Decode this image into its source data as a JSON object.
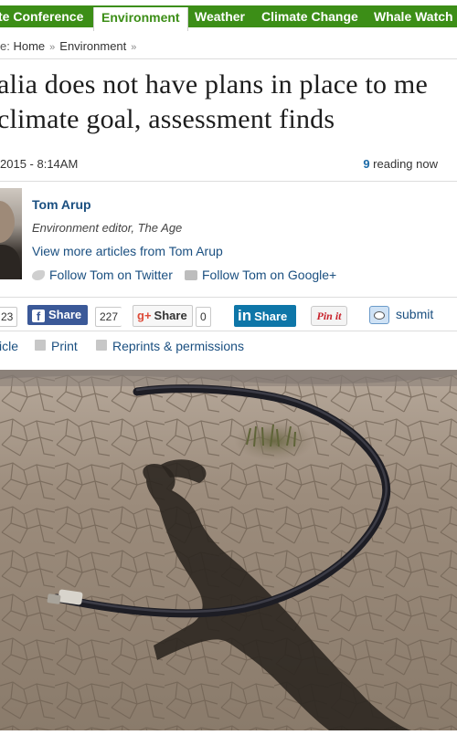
{
  "nav": {
    "items": [
      {
        "label": "te Conference",
        "active": false
      },
      {
        "label": "Environment",
        "active": true
      },
      {
        "label": "Weather",
        "active": false
      },
      {
        "label": "Climate Change",
        "active": false
      },
      {
        "label": "Whale Watch",
        "active": false
      }
    ]
  },
  "breadcrumb": {
    "prefix": "e:",
    "items": [
      "Home",
      "Environment"
    ],
    "separator": "»"
  },
  "article": {
    "headline_lines": [
      "alia does not have plans in place to me",
      "climate goal, assessment finds"
    ],
    "date": "2015 - 8:14AM",
    "reading_count": "9",
    "reading_label": " reading now"
  },
  "author": {
    "name": "Tom Arup",
    "role": "Environment editor, The Age",
    "more_link": "View more articles from Tom Arup",
    "twitter": "Follow Tom on Twitter",
    "google": "Follow Tom on Google+"
  },
  "share": {
    "count_prev": "23",
    "facebook_label": "Share",
    "facebook_count": "227",
    "gplus_label": "Share",
    "gplus_count": "0",
    "linkedin_label": "Share",
    "pinterest_label": "Pin it",
    "reddit_label": "submit"
  },
  "tools": {
    "email": "icle",
    "print": "Print",
    "reprints": "Reprints & permissions"
  },
  "colors": {
    "nav_green": "#3c8e17",
    "link_blue": "#1a4f80",
    "facebook": "#3b5998",
    "linkedin": "#0e76a8"
  }
}
